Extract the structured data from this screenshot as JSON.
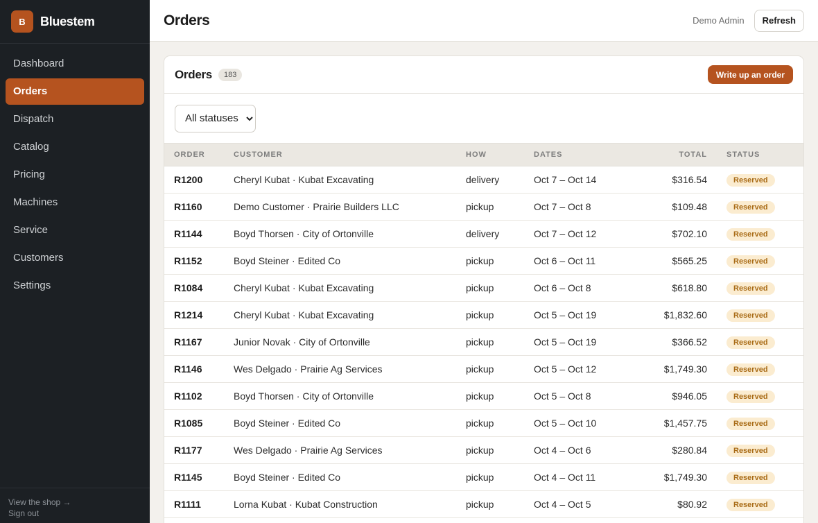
{
  "brand": {
    "mark": "B",
    "name": "Bluestem"
  },
  "nav": {
    "items": [
      {
        "label": "Dashboard",
        "name": "dashboard"
      },
      {
        "label": "Orders",
        "name": "orders",
        "active": true
      },
      {
        "label": "Dispatch",
        "name": "dispatch"
      },
      {
        "label": "Catalog",
        "name": "catalog"
      },
      {
        "label": "Pricing",
        "name": "pricing"
      },
      {
        "label": "Machines",
        "name": "machines"
      },
      {
        "label": "Service",
        "name": "service"
      },
      {
        "label": "Customers",
        "name": "customers"
      },
      {
        "label": "Settings",
        "name": "settings"
      }
    ],
    "footer": {
      "view_shop": "View the shop →",
      "sign_out": "Sign out"
    }
  },
  "topbar": {
    "title": "Orders",
    "user": "Demo Admin",
    "refresh_label": "Refresh"
  },
  "card": {
    "title": "Orders",
    "count": "183",
    "new_order_label": "Write up an order",
    "filter": {
      "selected": "All statuses"
    }
  },
  "table": {
    "columns": {
      "order": "ORDER",
      "customer": "CUSTOMER",
      "how": "HOW",
      "dates": "DATES",
      "total": "TOTAL",
      "status": "STATUS"
    },
    "rows": [
      {
        "order": "R1200",
        "customer": "Cheryl Kubat · Kubat Excavating",
        "how": "delivery",
        "dates": "Oct 7 – Oct 14",
        "total": "$316.54",
        "status": "Reserved"
      },
      {
        "order": "R1160",
        "customer": "Demo Customer · Prairie Builders LLC",
        "how": "pickup",
        "dates": "Oct 7 – Oct 8",
        "total": "$109.48",
        "status": "Reserved"
      },
      {
        "order": "R1144",
        "customer": "Boyd Thorsen · City of Ortonville",
        "how": "delivery",
        "dates": "Oct 7 – Oct 12",
        "total": "$702.10",
        "status": "Reserved"
      },
      {
        "order": "R1152",
        "customer": "Boyd Steiner · Edited Co",
        "how": "pickup",
        "dates": "Oct 6 – Oct 11",
        "total": "$565.25",
        "status": "Reserved"
      },
      {
        "order": "R1084",
        "customer": "Cheryl Kubat · Kubat Excavating",
        "how": "pickup",
        "dates": "Oct 6 – Oct 8",
        "total": "$618.80",
        "status": "Reserved"
      },
      {
        "order": "R1214",
        "customer": "Cheryl Kubat · Kubat Excavating",
        "how": "pickup",
        "dates": "Oct 5 – Oct 19",
        "total": "$1,832.60",
        "status": "Reserved"
      },
      {
        "order": "R1167",
        "customer": "Junior Novak · City of Ortonville",
        "how": "pickup",
        "dates": "Oct 5 – Oct 19",
        "total": "$366.52",
        "status": "Reserved"
      },
      {
        "order": "R1146",
        "customer": "Wes Delgado · Prairie Ag Services",
        "how": "pickup",
        "dates": "Oct 5 – Oct 12",
        "total": "$1,749.30",
        "status": "Reserved"
      },
      {
        "order": "R1102",
        "customer": "Boyd Thorsen · City of Ortonville",
        "how": "pickup",
        "dates": "Oct 5 – Oct 8",
        "total": "$946.05",
        "status": "Reserved"
      },
      {
        "order": "R1085",
        "customer": "Boyd Steiner · Edited Co",
        "how": "pickup",
        "dates": "Oct 5 – Oct 10",
        "total": "$1,457.75",
        "status": "Reserved"
      },
      {
        "order": "R1177",
        "customer": "Wes Delgado · Prairie Ag Services",
        "how": "pickup",
        "dates": "Oct 4 – Oct 6",
        "total": "$280.84",
        "status": "Reserved"
      },
      {
        "order": "R1145",
        "customer": "Boyd Steiner · Edited Co",
        "how": "pickup",
        "dates": "Oct 4 – Oct 11",
        "total": "$1,749.30",
        "status": "Reserved"
      },
      {
        "order": "R1111",
        "customer": "Lorna Kubat · Kubat Construction",
        "how": "pickup",
        "dates": "Oct 4 – Oct 5",
        "total": "$80.92",
        "status": "Reserved"
      }
    ]
  },
  "colors": {
    "accent": "#b5531f",
    "sidebar_bg": "#1c2024",
    "status_reserved_bg": "#fbecd0",
    "status_reserved_text": "#a86a14"
  }
}
